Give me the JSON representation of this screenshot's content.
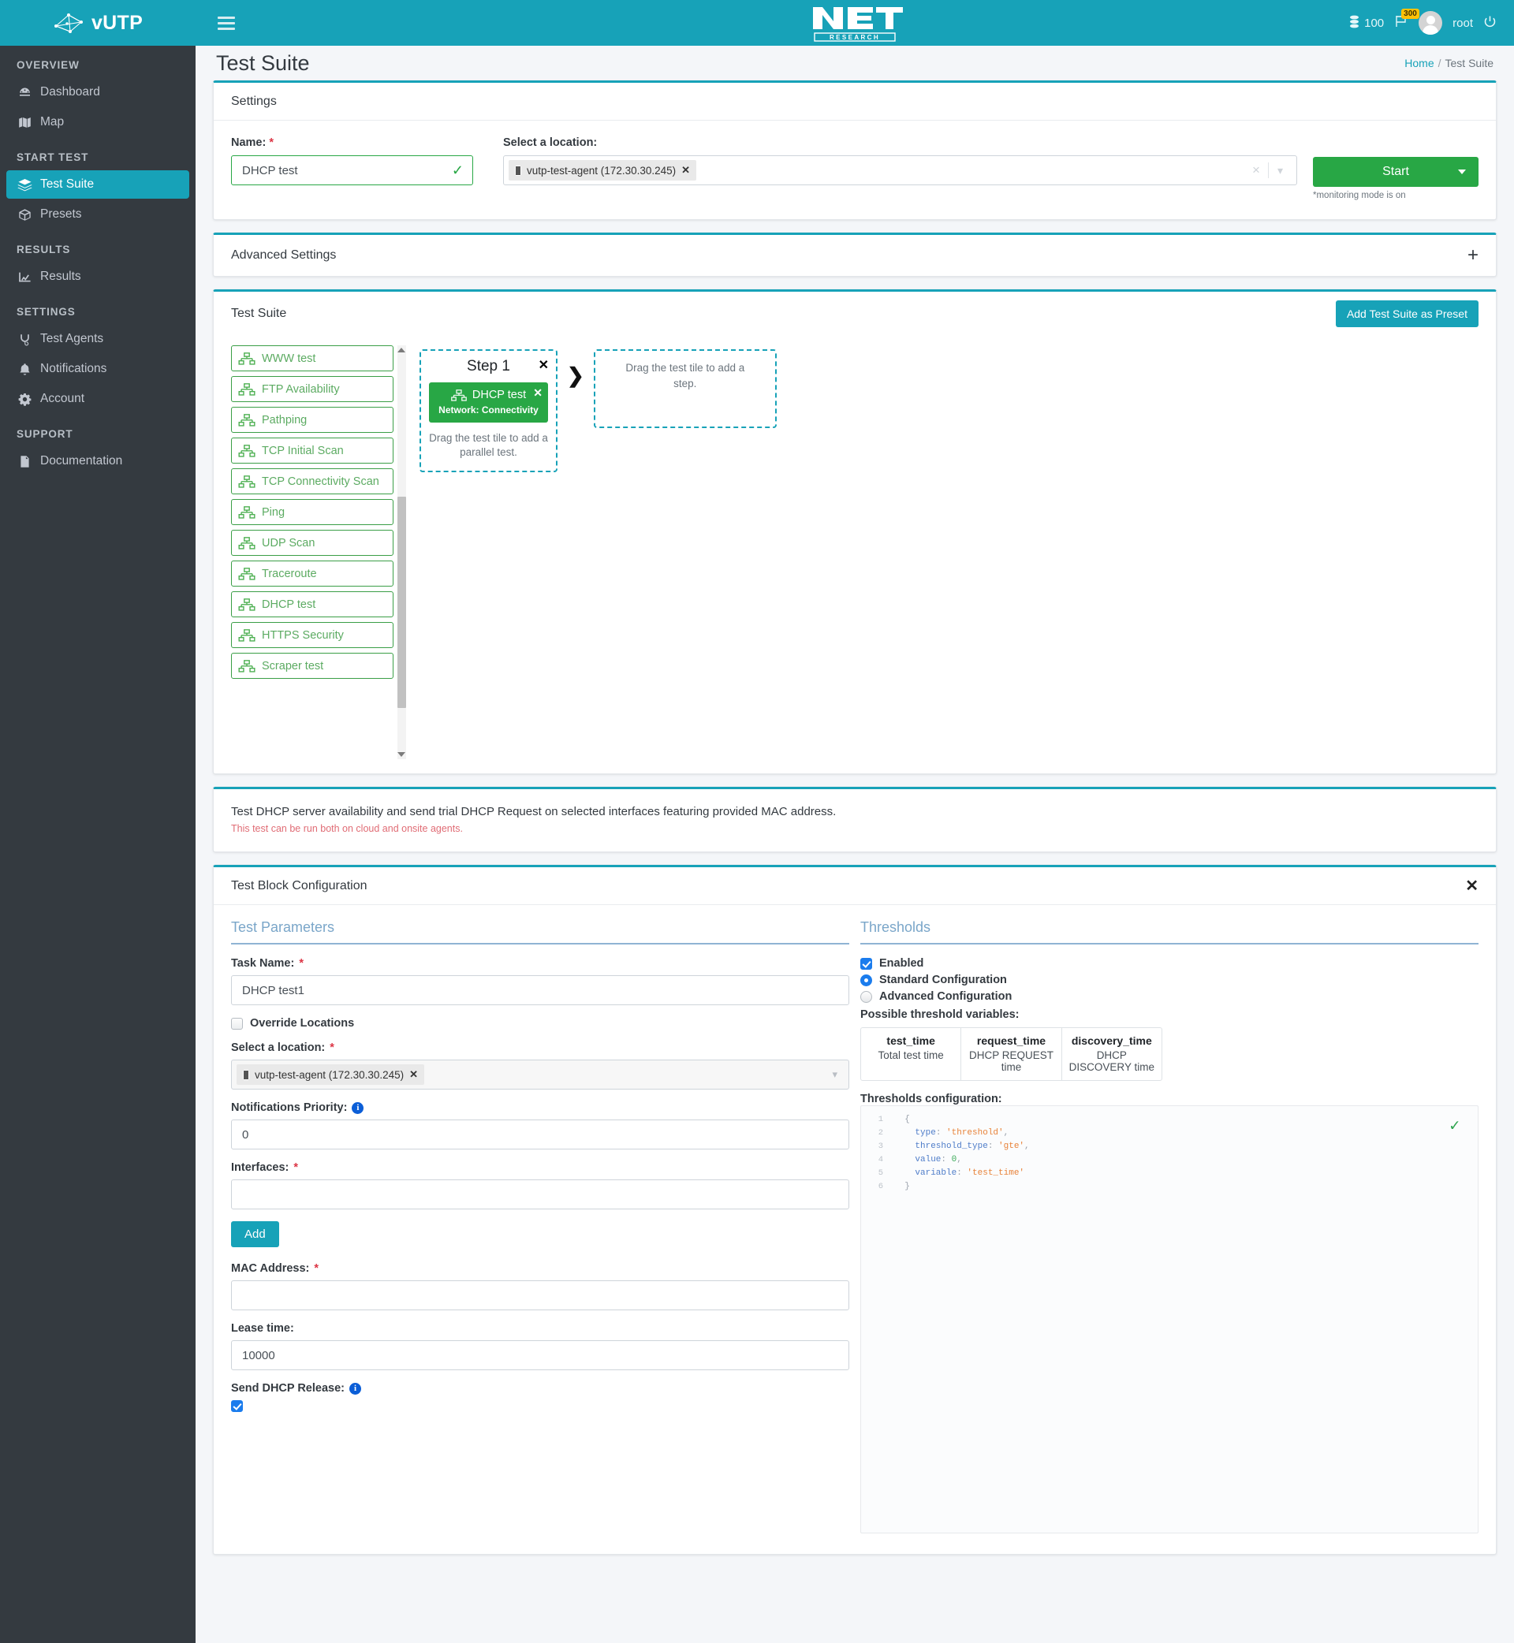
{
  "brand": {
    "name": "vUTP",
    "logo_icon": "network-graph-icon"
  },
  "topbar": {
    "menu_icon": "hamburger-icon",
    "company_logo": "net-research-logo",
    "company_logo_text": "NET",
    "company_logo_subtext": "RESEARCH",
    "coins": "100",
    "coins_icon": "coins-icon",
    "flag_icon": "flag-icon",
    "flag_badge": "300",
    "user": "root",
    "avatar_icon": "user-avatar-icon",
    "power_icon": "power-icon"
  },
  "sidebar": {
    "sections": [
      {
        "label": "OVERVIEW",
        "items": [
          {
            "label": "Dashboard",
            "icon": "dashboard-icon",
            "active": false
          },
          {
            "label": "Map",
            "icon": "map-icon",
            "active": false
          }
        ]
      },
      {
        "label": "START TEST",
        "items": [
          {
            "label": "Test Suite",
            "icon": "test-suite-icon",
            "active": true
          },
          {
            "label": "Presets",
            "icon": "box-icon",
            "active": false
          }
        ]
      },
      {
        "label": "RESULTS",
        "items": [
          {
            "label": "Results",
            "icon": "chart-line-icon",
            "active": false
          }
        ]
      },
      {
        "label": "SETTINGS",
        "items": [
          {
            "label": "Test Agents",
            "icon": "agents-icon",
            "active": false
          },
          {
            "label": "Notifications",
            "icon": "bell-icon",
            "active": false
          },
          {
            "label": "Account",
            "icon": "gear-icon",
            "active": false
          }
        ]
      },
      {
        "label": "SUPPORT",
        "items": [
          {
            "label": "Documentation",
            "icon": "document-icon",
            "active": false
          }
        ]
      }
    ]
  },
  "page": {
    "title": "Test Suite",
    "breadcrumb_home": "Home",
    "breadcrumb_sep": "/",
    "breadcrumb_current": "Test Suite"
  },
  "settings": {
    "header": "Settings",
    "name_label": "Name:",
    "name_value": "DHCP test",
    "name_valid_icon": "checkmark-icon",
    "location_label": "Select a location:",
    "location_chip": "vutp-test-agent (172.30.30.245)",
    "location_chip_remove": "✕",
    "clear_icon": "×",
    "dropdown_icon": "⌄",
    "start_label": "Start",
    "start_note": "*monitoring mode is on"
  },
  "advanced": {
    "header": "Advanced Settings",
    "expand_icon": "plus-icon",
    "expand_label": "+"
  },
  "test_suite": {
    "header": "Test Suite",
    "preset_button": "Add Test Suite as Preset",
    "tiles": [
      "WWW test",
      "FTP Availability",
      "Pathping",
      "TCP Initial Scan",
      "TCP Connectivity Scan",
      "Ping",
      "UDP Scan",
      "Traceroute",
      "DHCP test",
      "HTTPS Security",
      "Scraper test"
    ],
    "step": {
      "title": "Step 1",
      "close": "✕",
      "tile_name": "DHCP test",
      "tile_category": "Network: Connectivity",
      "tile_close": "✕",
      "hint": "Drag the test tile to add a parallel test."
    },
    "arrow_icon": "chevron-right-icon",
    "dropzone_hint": "Drag the test tile to add a step."
  },
  "description": {
    "main": "Test DHCP server availability and send trial DHCP Request on selected interfaces featuring provided MAC address.",
    "note": "This test can be run both on cloud and onsite agents."
  },
  "tbc": {
    "header": "Test Block Configuration",
    "close": "✕",
    "params_title": "Test Parameters",
    "task_name_label": "Task Name:",
    "task_name_value": "DHCP test1",
    "override_label": "Override Locations",
    "location_label": "Select a location:",
    "location_chip": "vutp-test-agent (172.30.30.245)",
    "location_chip_remove": "✕",
    "notif_label": "Notifications Priority:",
    "notif_value": "0",
    "interfaces_label": "Interfaces:",
    "interfaces_value": "",
    "add_button": "Add",
    "mac_label": "MAC Address:",
    "mac_value": "",
    "lease_label": "Lease time:",
    "lease_value": "10000",
    "release_label": "Send DHCP Release:",
    "thresholds_title": "Thresholds",
    "enabled_label": "Enabled",
    "standard_label": "Standard Configuration",
    "advanced_label": "Advanced Configuration",
    "vars_label": "Possible threshold variables:",
    "vars": [
      {
        "name": "test_time",
        "desc": "Total test time"
      },
      {
        "name": "request_time",
        "desc": "DHCP REQUEST time"
      },
      {
        "name": "discovery_time",
        "desc": "DHCP DISCOVERY time"
      }
    ],
    "config_label": "Thresholds configuration:",
    "code": [
      {
        "n": "1",
        "parts": [
          {
            "t": "{",
            "c": "tok-pun"
          }
        ],
        "indent": 2
      },
      {
        "n": "2",
        "parts": [
          {
            "t": "type",
            "c": "tok-key"
          },
          {
            "t": ": ",
            "c": "tok-pun"
          },
          {
            "t": "'threshold'",
            "c": "tok-str"
          },
          {
            "t": ",",
            "c": "tok-pun"
          }
        ],
        "indent": 4
      },
      {
        "n": "3",
        "parts": [
          {
            "t": "threshold_type",
            "c": "tok-key"
          },
          {
            "t": ": ",
            "c": "tok-pun"
          },
          {
            "t": "'gte'",
            "c": "tok-str"
          },
          {
            "t": ",",
            "c": "tok-pun"
          }
        ],
        "indent": 4
      },
      {
        "n": "4",
        "parts": [
          {
            "t": "value",
            "c": "tok-key"
          },
          {
            "t": ": ",
            "c": "tok-pun"
          },
          {
            "t": "0",
            "c": "tok-num"
          },
          {
            "t": ",",
            "c": "tok-pun"
          }
        ],
        "indent": 4
      },
      {
        "n": "5",
        "parts": [
          {
            "t": "variable",
            "c": "tok-key"
          },
          {
            "t": ": ",
            "c": "tok-pun"
          },
          {
            "t": "'test_time'",
            "c": "tok-str"
          }
        ],
        "indent": 4
      },
      {
        "n": "6",
        "parts": [
          {
            "t": "}",
            "c": "tok-pun"
          }
        ],
        "indent": 2
      }
    ],
    "code_valid_icon": "checkmark-icon"
  },
  "colors": {
    "accent": "#17a2b8",
    "sidebar": "#343a40",
    "success": "#28a745",
    "danger": "#dc3545",
    "warning": "#ffc107",
    "page_bg": "#f4f6f9"
  }
}
